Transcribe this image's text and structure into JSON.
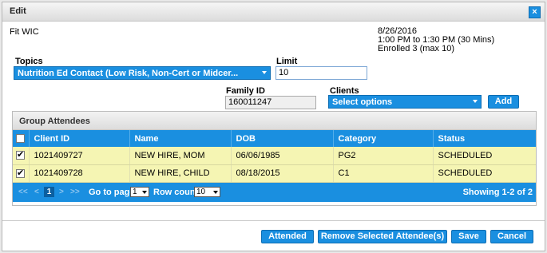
{
  "dialog": {
    "title": "Edit",
    "close_symbol": "×"
  },
  "event": {
    "name": "Fit WIC",
    "date": "8/26/2016",
    "time": "1:00 PM to 1:30 PM (30 Mins)",
    "enrolled": "Enrolled 3 (max 10)"
  },
  "form": {
    "topics_label": "Topics",
    "topics_value": "Nutrition Ed Contact (Low Risk, Non-Cert or Midcer...",
    "limit_label": "Limit",
    "limit_value": "10",
    "family_id_label": "Family ID",
    "family_id_value": "160011247",
    "clients_label": "Clients",
    "clients_placeholder": "Select options",
    "add_label": "Add"
  },
  "attendees": {
    "panel_title": "Group Attendees",
    "columns": [
      "Client ID",
      "Name",
      "DOB",
      "Category",
      "Status"
    ],
    "rows": [
      {
        "checked": true,
        "client_id": "1021409727",
        "name": "NEW HIRE, MOM",
        "dob": "06/06/1985",
        "category": "PG2",
        "status": "SCHEDULED"
      },
      {
        "checked": true,
        "client_id": "1021409728",
        "name": "NEW HIRE, CHILD",
        "dob": "08/18/2015",
        "category": "C1",
        "status": "SCHEDULED"
      }
    ],
    "pager": {
      "first": "<<",
      "prev": "<",
      "page": "1",
      "next": ">",
      "last": ">>",
      "goto_label": "Go to page:",
      "goto_value": "1",
      "rowcount_label": "Row count:",
      "rowcount_value": "10",
      "showing": "Showing 1-2 of 2"
    }
  },
  "footer": {
    "attended": "Attended",
    "remove": "Remove Selected Attendee(s)",
    "save": "Save",
    "cancel": "Cancel"
  },
  "colors": {
    "accent": "#1a8fe0",
    "row_highlight": "#f5f5b3"
  }
}
